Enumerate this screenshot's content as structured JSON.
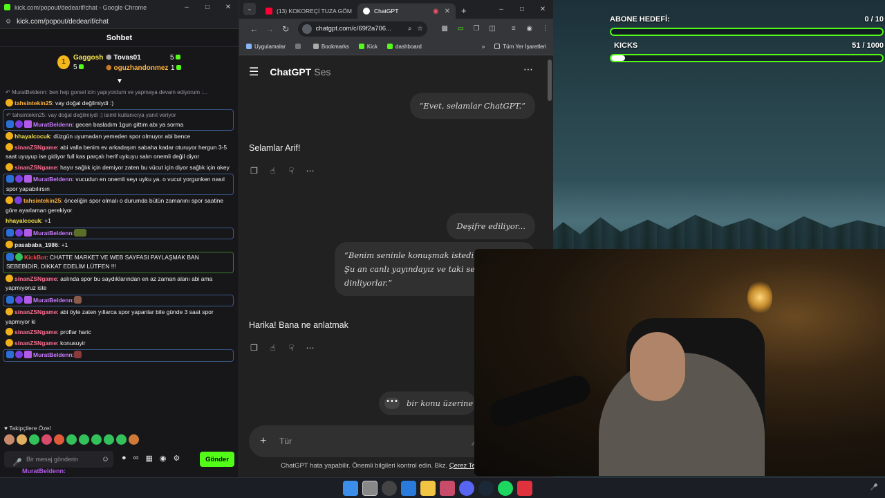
{
  "chat_window": {
    "tab_title": "kick.com/popout/dedearif/chat - Google Chrome",
    "url": "kick.com/popout/dedearif/chat",
    "header": "Sohbet",
    "leaderboard": [
      {
        "rank": "1",
        "name": "Gaggosh",
        "count": "5"
      },
      {
        "rank": "",
        "name": "Tovas01",
        "count": "5"
      },
      {
        "rank": "",
        "name": "oguzhandonmez",
        "count": "1"
      }
    ],
    "messages": [
      {
        "reply": "MuratBeldenn: ben hep gorsel icin yapıyordum ve yapmaya devam ediyorum :..."
      },
      {
        "user": "tahsintekin25",
        "text": ": vay doğal değilmiydi :)",
        "color": "orange"
      },
      {
        "reply": "tahsintekin25: vay doğal değilmiydi :) isimli kullanıcıya yanıt veriyor"
      },
      {
        "user": "MuratBeldenn",
        "text": ": gecen basladım 1gun gittım abı ya sorma",
        "color": "purple"
      },
      {
        "user": "hhayalcocuk",
        "text": ": düzgün uyumadan yemeden spor olmuyor abi bence",
        "color": "yellow"
      },
      {
        "user": "sinanZSNgame",
        "text": ": abi valla benim ev arkadaşım sabaha kadar oturuyor hergun 3-5 saat uyuyup ise gidiyor full kas parçalı herif uykuyu salın onemli değil diyor",
        "color": "pink"
      },
      {
        "user": "sinanZSNgame",
        "text": ": hayır sağlık için demiyor zaten bu vücut için diyor sağlık için okey",
        "color": "pink"
      },
      {
        "user": "MuratBeldenn",
        "text": ": vucudun en onemli seyı uyku ya. o vucut yorgunken nasıl spor yapabılırsın",
        "color": "purple"
      },
      {
        "user": "tahsintekin25",
        "text": ": önceliğin spor olmalı o durumda bütün zamanını spor saatine göre ayarlaman gerekiyor",
        "color": "orange"
      },
      {
        "user": "hhayalcocuk",
        "text": ": +1",
        "color": "yellow"
      },
      {
        "user": "MuratBeldenn",
        "text": ":",
        "color": "purple"
      },
      {
        "user": "pasababa_1986",
        "text": ": +1",
        "color": "grey"
      },
      {
        "user": "KickBot",
        "text": ": CHATTE MARKET VE WEB SAYFASI PAYLAŞMAK BAN SEBEBİDİR. DİKKAT EDELİM LÜTFEN !!!",
        "color": "red"
      },
      {
        "user": "sinanZSNgame",
        "text": ": aslında spor bu saydıklarından en az zaman alanı abi ama yapmıyoruz iste",
        "color": "pink"
      },
      {
        "user": "MuratBeldenn",
        "text": ":",
        "color": "purple"
      },
      {
        "user": "sinanZSNgame",
        "text": ": abi öyle zaten yıllarca spor yapanlar bile günde 3 saat spor yapmıyor ki",
        "color": "pink"
      },
      {
        "user": "sinanZSNgame",
        "text": ": proflar haric",
        "color": "pink"
      },
      {
        "user": "sinanZSNgame",
        "text": ": konusuyir",
        "color": "pink"
      },
      {
        "user": "MuratBeldenn",
        "text": ":",
        "color": "purple"
      }
    ],
    "followers_label": "Takipçilere Özel",
    "input_placeholder": "Bir mesaj gönderin",
    "send_label": "Gönder",
    "tail_user": "MuratBeldenn:"
  },
  "gpt_window": {
    "tabs": [
      {
        "label": "(13) KOKOREÇİ TUZA GÖM",
        "active": false
      },
      {
        "label": "ChatGPT",
        "active": true
      }
    ],
    "url": "chatgpt.com/c/69f2a706...",
    "bookmarks": [
      "Uygulamalar",
      "Bookmarks",
      "Kick",
      "dashboard",
      "Tüm Yer İşaretleri"
    ],
    "title": "ChatGPT",
    "subtitle": "Ses",
    "conversation": {
      "user1": "“Evet, selamlar ChatGPT.”",
      "assistant1": "Selamlar Arif!",
      "transcribing": "Deşifre ediliyor...",
      "user2": "“Benim seninle konuşmak istediğim bi var. Şu an canlı yayındayız ve taki seni dinliyorlar.”",
      "assistant2": "Harika! Bana ne anlatmak",
      "typing": "bir konu üzerine t"
    },
    "composer_placeholder": "Tür",
    "footnote": "ChatGPT hata yapabilir. Önemli bilgileri kontrol edin. Bkz.",
    "footnote_link": "Çerez Tercı..."
  },
  "stream_overlay": {
    "sub_goal_label": "ABONE HEDEFİ:",
    "sub_goal_value": "0 / 10",
    "sub_goal_progress": 0,
    "kicks_label": "KICKS",
    "kicks_value": "51 / 1000",
    "kicks_progress": 0.051
  },
  "colors": {
    "kick_green": "#53fc18",
    "gpt_bg": "#212121",
    "chat_bg": "#17171a"
  }
}
